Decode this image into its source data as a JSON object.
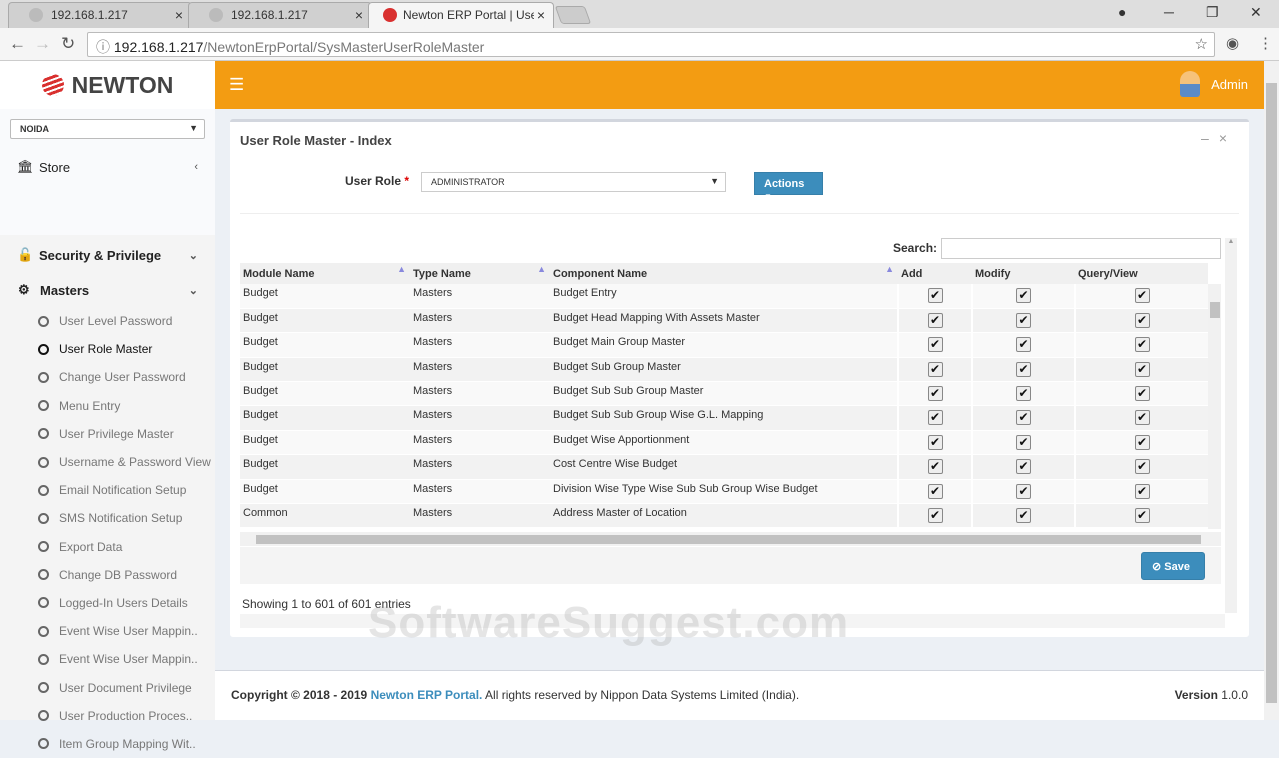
{
  "browser": {
    "tabs": [
      "192.168.1.217",
      "192.168.1.217",
      "Newton ERP Portal | User"
    ],
    "url_host": "192.168.1.217",
    "url_path": "/NewtonErpPortal/SysMasterUserRoleMaster"
  },
  "sidebar": {
    "logo": "NEWTON",
    "location": "NOIDA",
    "store": "Store",
    "security": "Security & Privilege",
    "masters": "Masters",
    "items": [
      "User Level Password",
      "User Role Master",
      "Change User Password",
      "Menu Entry",
      "User Privilege Master",
      "Username & Password View",
      "Email Notification Setup",
      "SMS Notification Setup",
      "Export Data",
      "Change DB Password",
      "Logged-In Users Details",
      "Event Wise User Mappin..",
      "Event Wise User Mappin..",
      "User Document Privilege",
      "User Production Proces..",
      "Item Group Mapping Wit.."
    ],
    "active_index": 1
  },
  "header": {
    "user": "Admin"
  },
  "panel": {
    "title": "User Role Master - Index",
    "role_label": "User Role",
    "role_value": "ADMINISTRATOR",
    "actions": "Actions",
    "search_label": "Search:",
    "save": "Save",
    "info": "Showing 1 to 601 of 601 entries"
  },
  "table": {
    "columns": [
      "Module Name",
      "Type Name",
      "Component Name",
      "Add",
      "Modify",
      "Query/View"
    ],
    "rows": [
      [
        "Budget",
        "Masters",
        "Budget Entry"
      ],
      [
        "Budget",
        "Masters",
        "Budget Head Mapping With Assets Master"
      ],
      [
        "Budget",
        "Masters",
        "Budget Main Group Master"
      ],
      [
        "Budget",
        "Masters",
        "Budget Sub Group Master"
      ],
      [
        "Budget",
        "Masters",
        "Budget Sub Sub Group Master"
      ],
      [
        "Budget",
        "Masters",
        "Budget Sub Sub Group Wise G.L. Mapping"
      ],
      [
        "Budget",
        "Masters",
        "Budget Wise Apportionment"
      ],
      [
        "Budget",
        "Masters",
        "Cost Centre Wise Budget"
      ],
      [
        "Budget",
        "Masters",
        "Division Wise Type Wise Sub Sub Group Wise Budget"
      ],
      [
        "Common",
        "Masters",
        "Address Master of Location"
      ]
    ]
  },
  "footer": {
    "copy": "Copyright © 2018 - 2019 ",
    "brand": "Newton ERP Portal.",
    "rest": " All rights reserved by Nippon Data Systems Limited (India).",
    "version_label": "Version",
    "version": "1.0.0"
  },
  "watermark": "SoftwareSuggest.com"
}
